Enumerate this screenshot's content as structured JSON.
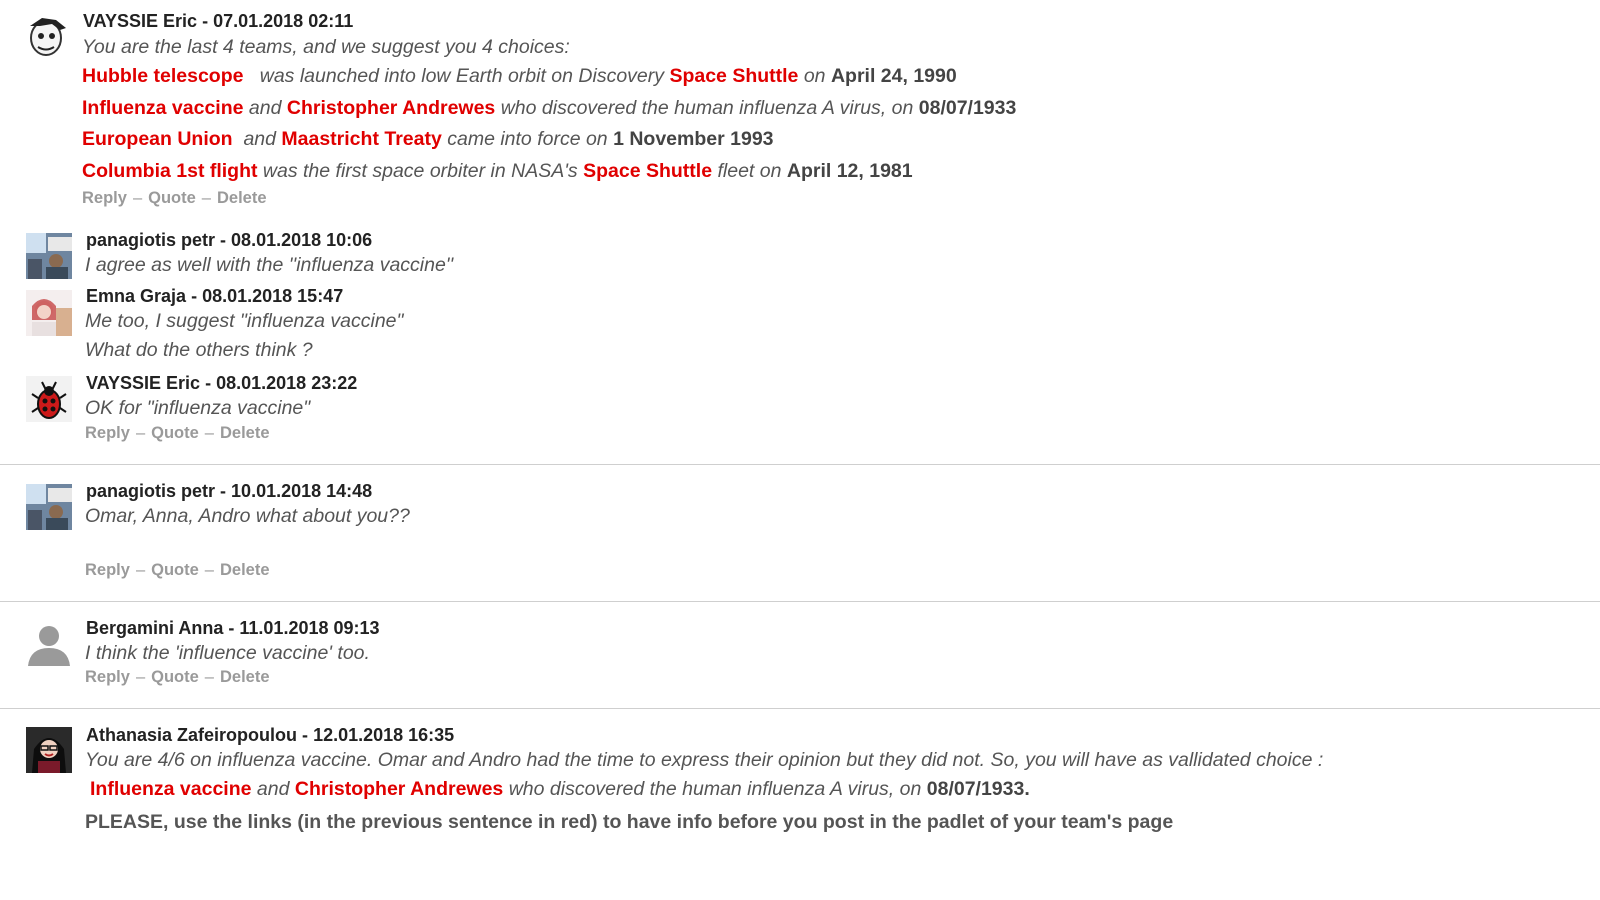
{
  "comments": [
    {
      "author": "VAYSSIE Eric",
      "date": "07.01.2018 02:11",
      "intro": "You are the last 4 teams, and we suggest you 4 choices:",
      "choices": [
        {
          "a": "Hubble telescope",
          "b": "was launched into low Earth orbit on Discovery",
          "c": "Space Shuttle",
          "d": "on",
          "e": "April 24, 1990"
        },
        {
          "a": "Influenza vaccine",
          "b": "and",
          "c": "Christopher Andrewes",
          "d": "who discovered the human influenza A virus, on",
          "e": "08/07/1933"
        },
        {
          "a": "European Union",
          "b": "and",
          "c": "Maastricht Treaty",
          "d": "came into force on",
          "e": "1 November 1993"
        },
        {
          "a": "Columbia 1st flight",
          "b": "was the first space orbiter in NASA's",
          "c": "Space Shuttle",
          "d": "fleet on",
          "e": "April 12, 1981"
        }
      ]
    },
    {
      "author": "panagiotis petr",
      "date": "08.01.2018 10:06",
      "text": "I agree as well with the ''influenza vaccine''"
    },
    {
      "author": "Emna Graja",
      "date": "08.01.2018 15:47",
      "text": "Me too, I suggest \"influenza vaccine\"",
      "text2": "What do the others think ?"
    },
    {
      "author": "VAYSSIE Eric",
      "date": "08.01.2018 23:22",
      "text": "OK for \"influenza vaccine\""
    },
    {
      "author": "panagiotis petr",
      "date": "10.01.2018 14:48",
      "text": "Omar, Anna, Andro what about you??"
    },
    {
      "author": "Bergamini Anna",
      "date": "11.01.2018 09:13",
      "text": "I think the 'influence vaccine' too."
    },
    {
      "author": "Athanasia Zafeiropoulou",
      "date": "12.01.2018 16:35",
      "text": "You are 4/6 on influenza vaccine. Omar and Andro had the time to express their opinion but they did not. So, you will have as vallidated choice :",
      "choice": {
        "a": "Influenza vaccine",
        "b": "and",
        "c": "Christopher Andrewes",
        "d": "who discovered the human influenza A virus, on",
        "e": "08/07/1933."
      },
      "note": "PLEASE, use the links (in the previous sentence in red) to have info before you post in the padlet of your team's page"
    }
  ],
  "actions": {
    "reply": "Reply",
    "quote": "Quote",
    "delete": "Delete",
    "sep": "–"
  },
  "meta_sep": "-"
}
